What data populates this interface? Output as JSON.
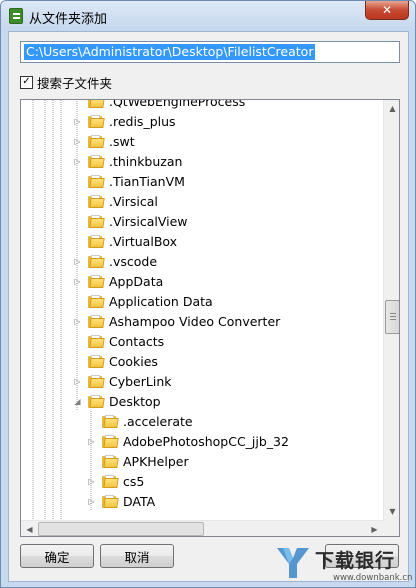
{
  "window": {
    "title": "从文件夹添加",
    "close_glyph": "✕"
  },
  "path_input": {
    "value": "C:\\Users\\Administrator\\Desktop\\FilelistCreator"
  },
  "search_subfolders": {
    "label": "搜索子文件夹",
    "checked": true,
    "check_glyph": "✓"
  },
  "tree": {
    "items": [
      {
        "label": ".QtWebEngineProcess",
        "level": 1,
        "expander": "none",
        "partial": true
      },
      {
        "label": ".redis_plus",
        "level": 1,
        "expander": "collapsed"
      },
      {
        "label": ".swt",
        "level": 1,
        "expander": "collapsed"
      },
      {
        "label": ".thinkbuzan",
        "level": 1,
        "expander": "collapsed"
      },
      {
        "label": ".TianTianVM",
        "level": 1,
        "expander": "none"
      },
      {
        "label": ".Virsical",
        "level": 1,
        "expander": "none"
      },
      {
        "label": ".VirsicalView",
        "level": 1,
        "expander": "none"
      },
      {
        "label": ".VirtualBox",
        "level": 1,
        "expander": "none"
      },
      {
        "label": ".vscode",
        "level": 1,
        "expander": "collapsed"
      },
      {
        "label": "AppData",
        "level": 1,
        "expander": "collapsed"
      },
      {
        "label": "Application Data",
        "level": 1,
        "expander": "none"
      },
      {
        "label": "Ashampoo Video Converter",
        "level": 1,
        "expander": "collapsed"
      },
      {
        "label": "Contacts",
        "level": 1,
        "expander": "none"
      },
      {
        "label": "Cookies",
        "level": 1,
        "expander": "none"
      },
      {
        "label": "CyberLink",
        "level": 1,
        "expander": "collapsed"
      },
      {
        "label": "Desktop",
        "level": 1,
        "expander": "expanded"
      },
      {
        "label": ".accelerate",
        "level": 2,
        "expander": "none"
      },
      {
        "label": "AdobePhotoshopCC_jjb_32",
        "level": 2,
        "expander": "collapsed"
      },
      {
        "label": "APKHelper",
        "level": 2,
        "expander": "none"
      },
      {
        "label": "cs5",
        "level": 2,
        "expander": "collapsed"
      },
      {
        "label": "DATA",
        "level": 2,
        "expander": "collapsed"
      }
    ],
    "expander_glyphs": {
      "collapsed": "▷",
      "expanded": "◢"
    },
    "vertical_scroll_fraction": 0.52
  },
  "scroll_glyphs": {
    "up": "▲",
    "down": "▼",
    "left": "◀",
    "right": "▶"
  },
  "buttons": {
    "ok_label": "确定",
    "cancel_label": "取消",
    "third_label": ""
  },
  "watermark": {
    "text": "下载银行",
    "url": "www.downbank.cn"
  },
  "colors": {
    "selection": "#3399ff",
    "folder": "#f1c440",
    "window_frame": "#c7d9ee",
    "close_button": "#c74a33"
  }
}
